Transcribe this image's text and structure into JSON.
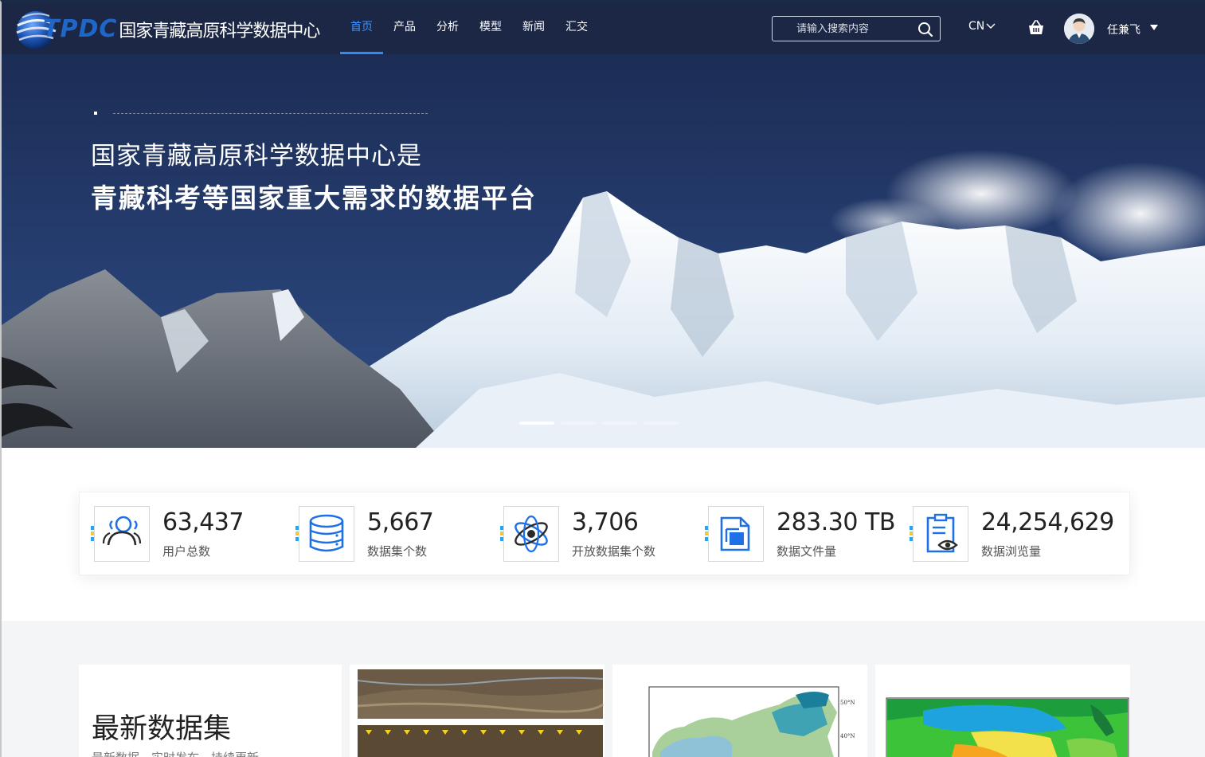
{
  "nav": {
    "logo_text": "TPDC",
    "site_name": "国家青藏高原科学数据中心",
    "menu": [
      {
        "label": "首页",
        "active": true
      },
      {
        "label": "产品",
        "active": false
      },
      {
        "label": "分析",
        "active": false
      },
      {
        "label": "模型",
        "active": false
      },
      {
        "label": "新闻",
        "active": false
      },
      {
        "label": "汇交",
        "active": false
      }
    ],
    "search_placeholder": "请输入搜索内容",
    "language": "CN",
    "username": "任兼飞",
    "accent_color": "#2d8cf0",
    "background_color": "#1b2744"
  },
  "hero": {
    "line1": "国家青藏高原科学数据中心是",
    "line2": "青藏科考等国家重大需求的数据平台",
    "slide_count": 4,
    "active_slide": 0
  },
  "stats": [
    {
      "value": "63,437",
      "label": "用户总数",
      "icon": "users-icon"
    },
    {
      "value": "5,667",
      "label": "数据集个数",
      "icon": "database-icon"
    },
    {
      "value": "3,706",
      "label": "开放数据集个数",
      "icon": "atom-icon"
    },
    {
      "value": "283.30 TB",
      "label": "数据文件量",
      "icon": "files-icon"
    },
    {
      "value": "24,254,629",
      "label": "数据浏览量",
      "icon": "clipboard-eye-icon"
    }
  ],
  "latest": {
    "title": "最新数据集",
    "subtitle": "最新数据，实时发布，持续更新",
    "map_labels": [
      "50°N",
      "40°N"
    ]
  }
}
